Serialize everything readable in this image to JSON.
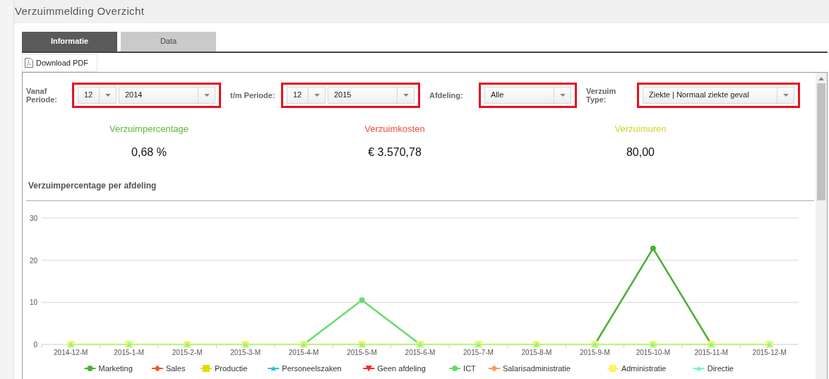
{
  "page": {
    "title": "Verzuimmelding Overzicht"
  },
  "tabs": [
    {
      "label": "Informatie",
      "selected": true
    },
    {
      "label": "Data",
      "selected": false
    }
  ],
  "download_button": {
    "label": "Download PDF"
  },
  "filters": [
    {
      "label": "Vanaf Periode:",
      "highlighted": true,
      "selects": [
        {
          "value": "12"
        },
        {
          "value": "2014"
        }
      ]
    },
    {
      "label": "t/m Periode:",
      "highlighted": true,
      "selects": [
        {
          "value": "12"
        },
        {
          "value": "2015"
        }
      ]
    },
    {
      "label": "Afdeling:",
      "highlighted": true,
      "selects": [
        {
          "value": "Alle"
        }
      ]
    },
    {
      "label": "Verzuim Type:",
      "highlighted": true,
      "selects": [
        {
          "value": "Ziekte | Normaal ziekte geval"
        }
      ]
    }
  ],
  "stats": [
    {
      "label": "Verzuimpercentage",
      "value": "0,68 %",
      "color": "#5cb83a"
    },
    {
      "label": "Verzuimkosten",
      "value": "€ 3.570,78",
      "color": "#f0503c"
    },
    {
      "label": "Verzuimuren",
      "value": "80,00",
      "color": "#d4d428"
    }
  ],
  "chart_section": {
    "title": "Verzuimpercentage per afdeling",
    "chart_data": {
      "type": "line",
      "legend": "bottom",
      "categories": [
        "2014-12-M",
        "2015-1-M",
        "2015-2-M",
        "2015-3-M",
        "2015-4-M",
        "2015-5-M",
        "2015-6-M",
        "2015-7-M",
        "2015-8-M",
        "2015-9-M",
        "2015-10-M",
        "2015-11-M",
        "2015-12-M"
      ],
      "ylim": [
        0,
        30
      ],
      "yticks": [
        0,
        10,
        20,
        30
      ],
      "series": [
        {
          "name": "Marketing",
          "color": "#4cb034",
          "marker": "circle",
          "values": [
            null,
            null,
            null,
            null,
            null,
            null,
            null,
            null,
            null,
            0,
            22.8,
            0,
            null
          ]
        },
        {
          "name": "Sales",
          "color": "#f4581e",
          "marker": "diamond",
          "values": [
            null,
            null,
            null,
            null,
            null,
            null,
            null,
            null,
            null,
            null,
            null,
            null,
            null
          ]
        },
        {
          "name": "Productie",
          "color": "#e0dc00",
          "marker": "square",
          "values": [
            null,
            null,
            null,
            null,
            null,
            null,
            null,
            null,
            null,
            null,
            null,
            null,
            null
          ]
        },
        {
          "name": "Personeelszaken",
          "color": "#2bc0e4",
          "marker": "triangle",
          "values": [
            null,
            null,
            null,
            null,
            null,
            null,
            null,
            null,
            null,
            null,
            null,
            null,
            null
          ]
        },
        {
          "name": "Geen afdeling",
          "color": "#f7282a",
          "marker": "triangle-down",
          "values": [
            null,
            null,
            null,
            null,
            null,
            null,
            null,
            null,
            null,
            null,
            null,
            null,
            null
          ]
        },
        {
          "name": "ICT",
          "color": "#66dd66",
          "marker": "circle",
          "values": [
            null,
            null,
            null,
            null,
            0,
            10.5,
            0,
            null,
            null,
            null,
            null,
            null,
            null
          ]
        },
        {
          "name": "Salarisadministratie",
          "color": "#ff9655",
          "marker": "diamond",
          "values": [
            null,
            null,
            null,
            null,
            null,
            null,
            null,
            null,
            null,
            null,
            null,
            null,
            null
          ]
        },
        {
          "name": "Administratie",
          "color": "#fff263",
          "marker": "square",
          "values": [
            0,
            0,
            0,
            0,
            0,
            0,
            0,
            0,
            0,
            0,
            0,
            0,
            0
          ]
        },
        {
          "name": "Directie",
          "color": "#6af9c4",
          "marker": "triangle",
          "values": [
            0,
            0,
            0,
            0,
            0,
            0,
            0,
            0,
            0,
            0,
            0,
            0,
            0
          ]
        }
      ]
    }
  }
}
